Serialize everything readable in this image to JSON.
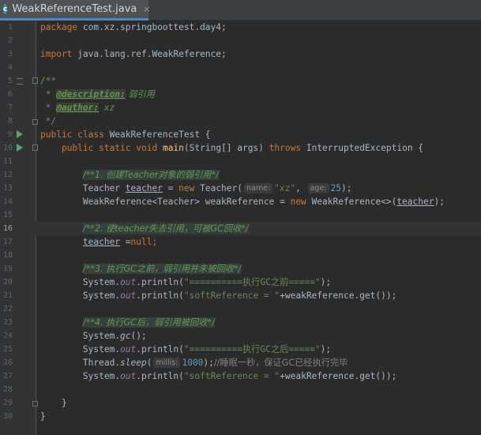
{
  "tab": {
    "title": "WeakReferenceTest.java",
    "icon_letter": "c",
    "close": "×"
  },
  "lines": {
    "n1": "1",
    "n2": "2",
    "n3": "3",
    "n4": "4",
    "n5": "5",
    "n6": "6",
    "n7": "7",
    "n8": "8",
    "n9": "9",
    "n10": "10",
    "n11": "11",
    "n12": "12",
    "n13": "13",
    "n14": "14",
    "n15": "15",
    "n16": "16",
    "n17": "17",
    "n18": "18",
    "n19": "19",
    "n20": "20",
    "n21": "21",
    "n22": "22",
    "n23": "23",
    "n24": "24",
    "n25": "25",
    "n26": "26",
    "n27": "27",
    "n28": "28",
    "n29": "29",
    "n30": "30"
  },
  "code": {
    "l1_kw": "package",
    "l1_rest": " com.xz.springboottest.day4;",
    "l3_kw": "import",
    "l3_rest": " java.lang.ref.WeakReference;",
    "l5": "/**",
    "l6_star": " * ",
    "l6_tag": "@description:",
    "l6_text": " 弱引用",
    "l7_star": " * ",
    "l7_tag": "@author:",
    "l7_text": " xz",
    "l8": " */",
    "l9_kw": "public class",
    "l9_rest": " WeakReferenceTest {",
    "l10_kw1": "public static void",
    "l10_method": "main",
    "l10_params": "(String[] args) ",
    "l10_kw2": "throws",
    "l10_rest": " InterruptedException {",
    "l12": "/**1. 创建Teacher对象的弱引用*/",
    "l13_type": "Teacher ",
    "l13_var": "teacher",
    "l13_eq": " = ",
    "l13_new": "new",
    "l13_ctor": " Teacher(",
    "l13_hint1": "name:",
    "l13_str": "\"xz\"",
    "l13_comma": ", ",
    "l13_hint2": "age:",
    "l13_num": "25",
    "l13_end": ");",
    "l14_a": "WeakReference<Teacher> weakReference = ",
    "l14_new": "new",
    "l14_b": " WeakReference<>(",
    "l14_var": "teacher",
    "l14_end": ");",
    "l16": "/**2. 使teacher失去引用，可被GC回收*/",
    "l17_var": "teacher",
    "l17_eq": " =",
    "l17_null": "null",
    "l17_end": ";",
    "l19": "/**3. 执行GC之前，弱引用并未被回收*/",
    "l20_a": "System.",
    "l20_out": "out",
    "l20_b": ".println(",
    "l20_str": "\"==========执行GC之前=====\"",
    "l20_end": ");",
    "l21_a": "System.",
    "l21_out": "out",
    "l21_b": ".println(",
    "l21_str": "\"softReference = \"",
    "l21_end": "+weakReference.get());",
    "l23": "/**4. 执行GC后，弱引用被回收*/",
    "l24_a": "System.",
    "l24_gc": "gc",
    "l24_end": "();",
    "l25_a": "System.",
    "l25_out": "out",
    "l25_b": ".println(",
    "l25_str": "\"==========执行GC之后=====\"",
    "l25_end": ");",
    "l26_a": "Thread.",
    "l26_sleep": "sleep",
    "l26_b": "(",
    "l26_hint": "millis:",
    "l26_num": "1000",
    "l26_c": ");",
    "l26_cmt": "//睡眠一秒，保证GC已经执行完毕",
    "l27_a": "System.",
    "l27_out": "out",
    "l27_b": ".println(",
    "l27_str": "\"softReference = \"",
    "l27_end": "+weakReference.get());",
    "l29": "}",
    "l30": "}"
  },
  "colors": {
    "background": "#2b2b2b",
    "keyword": "#cc7832",
    "string": "#6a8759",
    "number": "#6897bb",
    "doc_comment": "#629755",
    "method": "#ffc66d",
    "static_field": "#9876aa",
    "run_marker": "#59a869"
  }
}
